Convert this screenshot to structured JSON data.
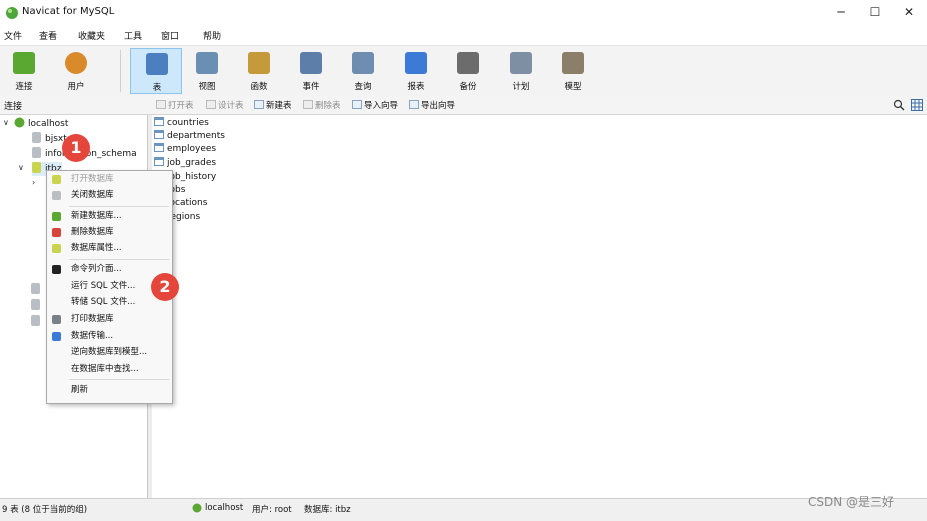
{
  "window": {
    "title": "Navicat for MySQL",
    "min": "─",
    "max": "☐",
    "close": "✕"
  },
  "menubar": [
    "文件",
    "查看",
    "收藏夹",
    "工具",
    "窗口",
    "帮助"
  ],
  "toolbar": [
    {
      "label": "连接",
      "icon": "connection-icon",
      "color": "#5aa832"
    },
    {
      "label": "用户",
      "icon": "user-icon",
      "color": "#d98a2b"
    },
    {
      "label": "表",
      "icon": "table-icon",
      "color": "#4c7fbf",
      "active": true
    },
    {
      "label": "视图",
      "icon": "view-icon",
      "color": "#6b8fb3"
    },
    {
      "label": "函数",
      "icon": "function-icon",
      "color": "#c59a3a"
    },
    {
      "label": "事件",
      "icon": "event-icon",
      "color": "#5d7ea8"
    },
    {
      "label": "查询",
      "icon": "query-icon",
      "color": "#6d8eb1"
    },
    {
      "label": "报表",
      "icon": "report-icon",
      "color": "#3b7ad6"
    },
    {
      "label": "备份",
      "icon": "backup-icon",
      "color": "#6c6c6c"
    },
    {
      "label": "计划",
      "icon": "schedule-icon",
      "color": "#7f8fa3"
    },
    {
      "label": "模型",
      "icon": "model-icon",
      "color": "#8b7f6a"
    }
  ],
  "subheader": {
    "connection_label": "连接",
    "buttons": [
      {
        "label": "打开表",
        "disabled": true
      },
      {
        "label": "设计表",
        "disabled": true
      },
      {
        "label": "新建表",
        "disabled": false
      },
      {
        "label": "删除表",
        "disabled": true
      },
      {
        "label": "导入向导",
        "disabled": false
      },
      {
        "label": "导出向导",
        "disabled": false
      }
    ]
  },
  "tree": {
    "root": "localhost",
    "databases": [
      "bjsxt",
      "information_schema",
      "itbz"
    ]
  },
  "tables": [
    "countries",
    "departments",
    "employees",
    "job_grades",
    "job_history",
    "jobs",
    "locations",
    "regions"
  ],
  "context_menu": [
    {
      "label": "打开数据库",
      "disabled": true,
      "icon": "open-database-icon"
    },
    {
      "label": "关闭数据库",
      "disabled": false,
      "icon": "close-database-icon"
    },
    {
      "sep": true
    },
    {
      "label": "新建数据库...",
      "disabled": false,
      "icon": "new-database-icon"
    },
    {
      "label": "删除数据库",
      "disabled": false,
      "icon": "delete-database-icon"
    },
    {
      "label": "数据库属性...",
      "disabled": false,
      "icon": "database-properties-icon"
    },
    {
      "sep": true
    },
    {
      "label": "命令列介面...",
      "disabled": false,
      "icon": "console-icon"
    },
    {
      "label": "运行 SQL 文件...",
      "disabled": false
    },
    {
      "label": "转储 SQL 文件...",
      "disabled": false
    },
    {
      "label": "打印数据库",
      "disabled": false,
      "icon": "print-icon"
    },
    {
      "label": "数据传输...",
      "disabled": false,
      "icon": "data-transfer-icon"
    },
    {
      "label": "逆向数据库到模型...",
      "disabled": false
    },
    {
      "label": "在数据库中查找...",
      "disabled": false
    },
    {
      "sep": true
    },
    {
      "label": "刷新",
      "disabled": false
    }
  ],
  "badges": [
    "1",
    "2"
  ],
  "statusbar": {
    "count": "9 表 (8 位于当前的组)",
    "host": "localhost",
    "user": "用户: root",
    "database": "数据库: itbz"
  },
  "watermark": "CSDN @是三好"
}
